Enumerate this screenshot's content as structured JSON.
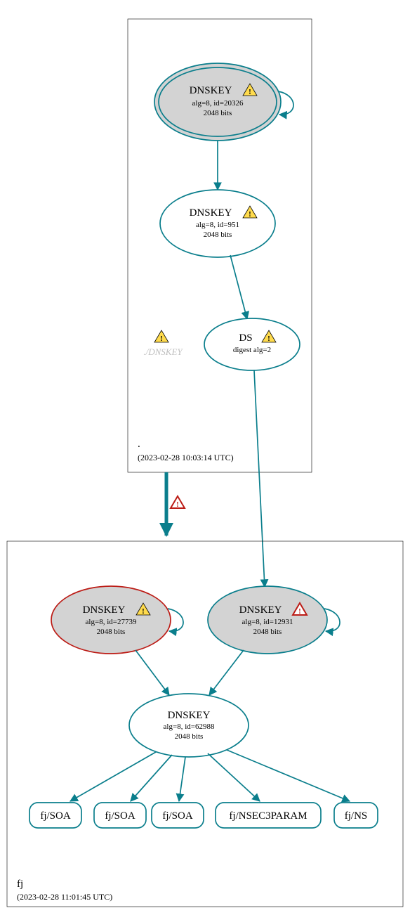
{
  "zones": {
    "root": {
      "label": ".",
      "timestamp": "(2023-02-28 10:03:14 UTC)",
      "nodes": {
        "ksk": {
          "title": "DNSKEY",
          "line1": "alg=8, id=20326",
          "line2": "2048 bits",
          "warn": "yellow"
        },
        "zsk": {
          "title": "DNSKEY",
          "line1": "alg=8, id=951",
          "line2": "2048 bits",
          "warn": "yellow"
        },
        "ds": {
          "title": "DS",
          "line1": "digest alg=2",
          "warn": "yellow"
        },
        "phantom": {
          "label": "./DNSKEY",
          "warn": "yellow"
        }
      }
    },
    "fj": {
      "label": "fj",
      "timestamp": "(2023-02-28 11:01:45 UTC)",
      "nodes": {
        "ksk1": {
          "title": "DNSKEY",
          "line1": "alg=8, id=27739",
          "line2": "2048 bits",
          "warn": "yellow"
        },
        "ksk2": {
          "title": "DNSKEY",
          "line1": "alg=8, id=12931",
          "line2": "2048 bits",
          "warn": "red"
        },
        "zsk": {
          "title": "DNSKEY",
          "line1": "alg=8, id=62988",
          "line2": "2048 bits"
        }
      },
      "rrsets": {
        "soa1": "fj/SOA",
        "soa2": "fj/SOA",
        "soa3": "fj/SOA",
        "nsec3p": "fj/NSEC3PARAM",
        "ns": "fj/NS"
      }
    }
  },
  "delegation_warn": "red"
}
